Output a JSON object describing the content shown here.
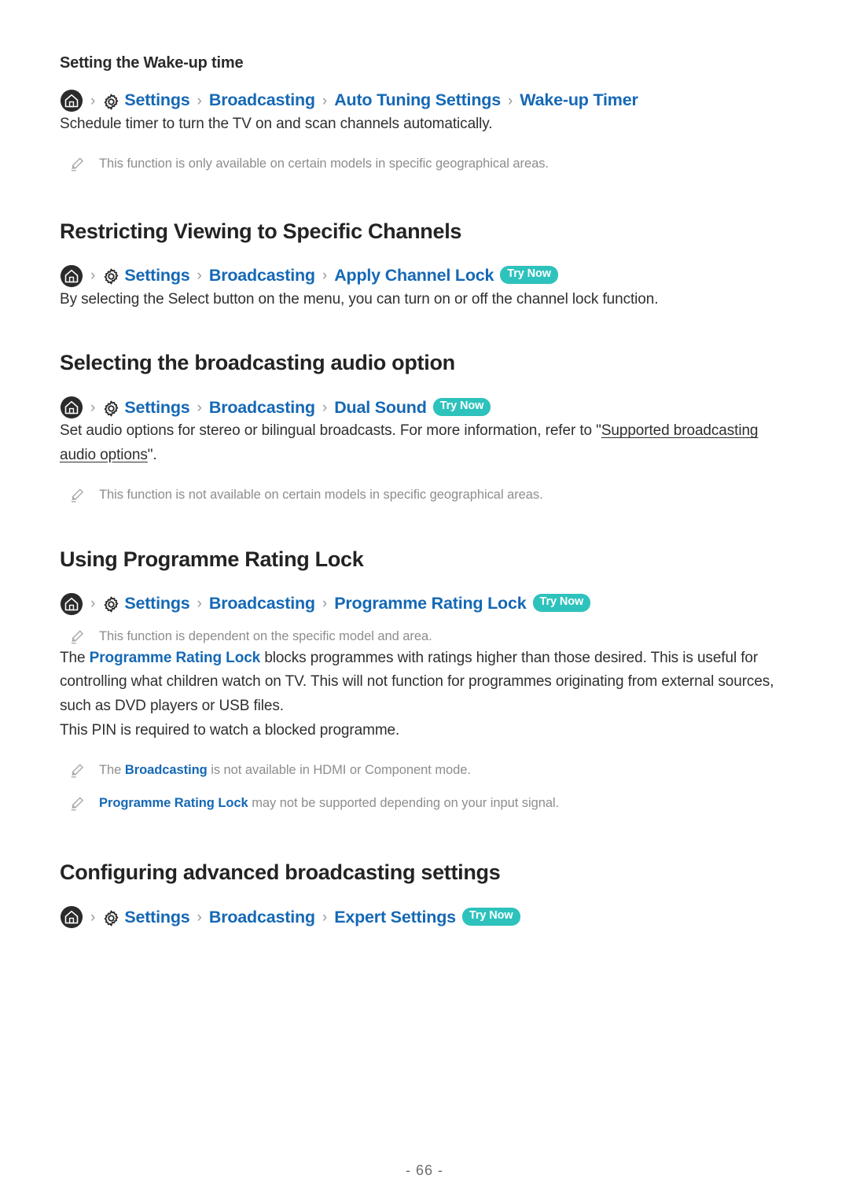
{
  "document": {
    "page_number": "- 66 -",
    "accent_link_color": "#1568b5",
    "badge_color": "#2ec2bd",
    "note_color": "#8d8d8d"
  },
  "sections": [
    {
      "heading": "Setting the Wake-up time",
      "heading_level": "sub",
      "breadcrumb": {
        "home_icon": "home-icon",
        "gear_icon": "gear-icon",
        "items": [
          "Settings",
          "Broadcasting",
          "Auto Tuning Settings",
          "Wake-up Timer"
        ],
        "separator": "›",
        "badge": ""
      },
      "paragraph": "Schedule timer to turn the TV on and scan channels automatically.",
      "note": "This function is only available on certain models in specific geographical areas."
    },
    {
      "heading": "Restricting Viewing to Specific Channels",
      "heading_level": "main",
      "breadcrumb": {
        "home_icon": "home-icon",
        "gear_icon": "gear-icon",
        "items": [
          "Settings",
          "Broadcasting",
          "Apply Channel Lock"
        ],
        "separator": "›",
        "badge": "Try Now"
      },
      "paragraph": "By selecting the Select button on the menu, you can turn on or off the channel lock function."
    },
    {
      "heading": "Selecting the broadcasting audio option",
      "heading_level": "main",
      "breadcrumb": {
        "home_icon": "home-icon",
        "gear_icon": "gear-icon",
        "items": [
          "Settings",
          "Broadcasting",
          "Dual Sound"
        ],
        "separator": "›",
        "badge": "Try Now"
      },
      "paragraph_parts": {
        "before": "Set audio options for stereo or bilingual broadcasts. For more information, refer to \"",
        "link": "Supported broadcasting audio options",
        "after": "\"."
      },
      "note": "This function is not available on certain models in specific geographical areas."
    },
    {
      "heading": "Using Programme Rating Lock",
      "heading_level": "main",
      "breadcrumb": {
        "home_icon": "home-icon",
        "gear_icon": "gear-icon",
        "items": [
          "Settings",
          "Broadcasting",
          "Programme Rating Lock"
        ],
        "separator": "›",
        "badge": "Try Now"
      },
      "note_top": "This function is dependent on the specific model and area.",
      "paragraph_1": {
        "before": "The ",
        "term": "Programme Rating Lock",
        "after": " blocks programmes with ratings higher than those desired. This is useful for controlling what children watch on TV. This will not function for programmes originating from external sources, such as DVD players or USB files."
      },
      "paragraph_2": "This PIN is required to watch a blocked programme.",
      "notes": [
        {
          "before": "The ",
          "term": "Broadcasting",
          "after": " is not available in HDMI or Component mode."
        },
        {
          "before": "",
          "term": "Programme Rating Lock",
          "after": " may not be supported depending on your input signal."
        }
      ]
    },
    {
      "heading": "Configuring advanced broadcasting settings",
      "heading_level": "main",
      "breadcrumb": {
        "home_icon": "home-icon",
        "gear_icon": "gear-icon",
        "items": [
          "Settings",
          "Broadcasting",
          "Expert Settings"
        ],
        "separator": "›",
        "badge": "Try Now"
      }
    }
  ]
}
